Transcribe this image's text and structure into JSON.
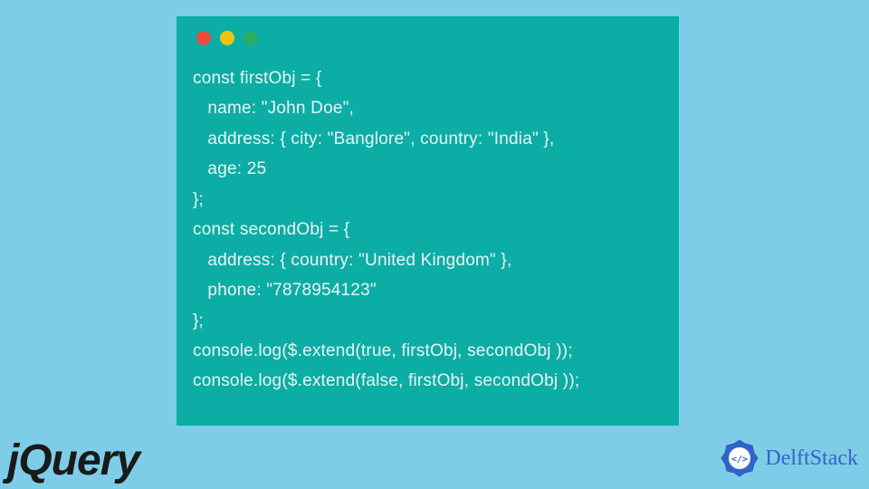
{
  "code": {
    "lines": [
      "const firstObj = {",
      "   name: \"John Doe\",",
      "   address: { city: \"Banglore\", country: \"India\" },",
      "   age: 25",
      "};",
      "const secondObj = {",
      "   address: { country: \"United Kingdom\" },",
      "   phone: \"7878954123\"",
      "};",
      "console.log($.extend(true, firstObj, secondObj ));",
      "console.log($.extend(false, firstObj, secondObj ));"
    ]
  },
  "jquery_label": "jQuery",
  "delftstack_label": "DelftStack"
}
